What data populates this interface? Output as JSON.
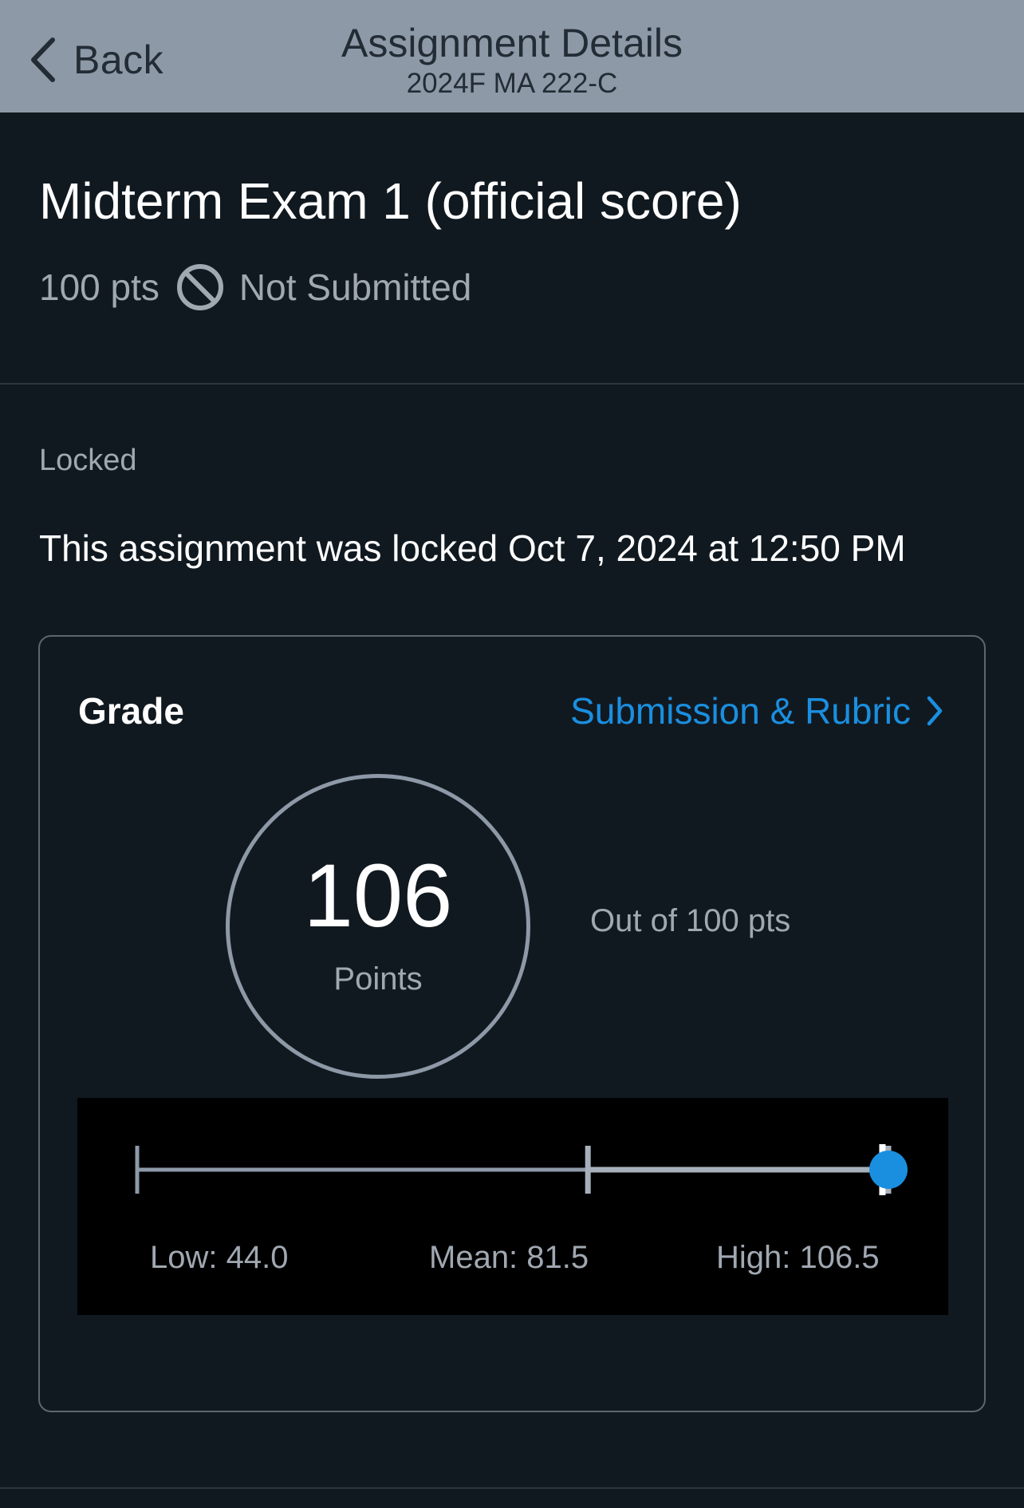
{
  "header": {
    "back_label": "Back",
    "title": "Assignment Details",
    "subtitle": "2024F MA 222-C"
  },
  "assignment": {
    "title": "Midterm Exam 1 (official score)",
    "points": "100 pts",
    "status": "Not Submitted",
    "status_icon": "ban-icon"
  },
  "lock": {
    "label": "Locked",
    "text": "This assignment was locked Oct 7, 2024 at 12:50 PM"
  },
  "grade": {
    "label": "Grade",
    "link_label": "Submission & Rubric",
    "score": "106",
    "score_unit": "Points",
    "out_of": "Out of 100 pts"
  },
  "distribution": {
    "low": 44.0,
    "mean": 81.5,
    "high": 106.5,
    "score": 106,
    "low_label": "Low: 44.0",
    "mean_label": "Mean: 81.5",
    "high_label": "High: 106.5"
  },
  "colors": {
    "accent": "#1a8fe0",
    "background": "#111920",
    "header": "#8d99a7"
  }
}
